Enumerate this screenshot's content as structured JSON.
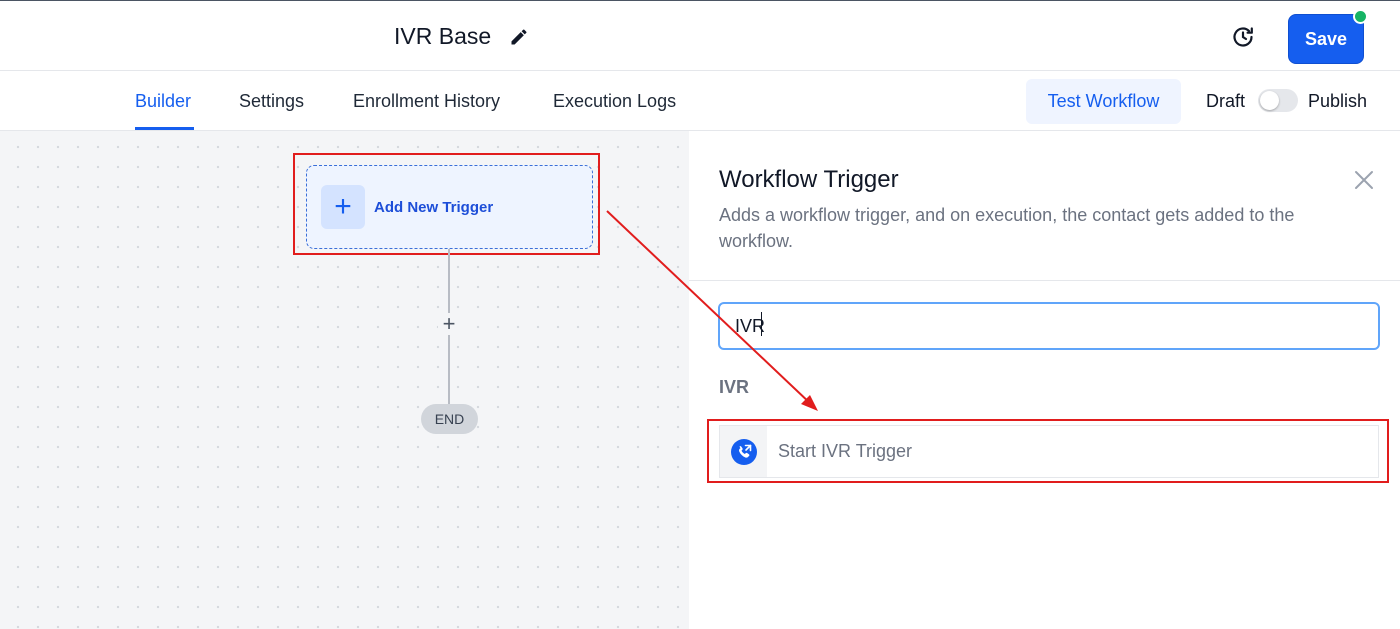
{
  "header": {
    "workflow_title": "IVR Base",
    "save_label": "Save"
  },
  "tabs": [
    {
      "label": "Builder",
      "active": true
    },
    {
      "label": "Settings",
      "active": false
    },
    {
      "label": "Enrollment History",
      "active": false
    },
    {
      "label": "Execution Logs",
      "active": false
    }
  ],
  "toolbar": {
    "test_workflow_label": "Test Workflow",
    "draft_label": "Draft",
    "publish_label": "Publish",
    "published": false
  },
  "canvas": {
    "add_trigger_label": "Add New Trigger",
    "add_step_symbol": "+",
    "end_label": "END"
  },
  "panel": {
    "title": "Workflow Trigger",
    "description": "Adds a workflow trigger, and on execution, the contact gets added to the workflow.",
    "search_value": "IVR",
    "section_label": "IVR",
    "results": [
      {
        "label": "Start IVR Trigger",
        "icon": "phone-ivr-icon"
      }
    ]
  },
  "colors": {
    "primary": "#155eef",
    "status_online": "#16b364",
    "annotation_red": "#e11d1d"
  }
}
